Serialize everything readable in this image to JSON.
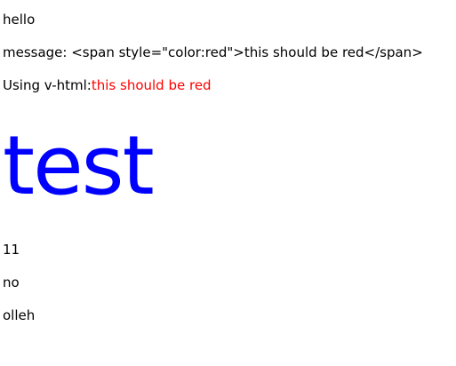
{
  "lines": {
    "greeting": "hello",
    "message_prefix": "message: ",
    "message_raw": "<span style=\"color:red\">this should be red</span>",
    "vhtml_prefix": "Using v-html:",
    "vhtml_rendered": "this should be red",
    "big_text": "test",
    "number": "11",
    "condition": "no",
    "reversed": "olleh"
  },
  "colors": {
    "text": "#000000",
    "red": "#ff0000",
    "blue": "#0000ff"
  }
}
